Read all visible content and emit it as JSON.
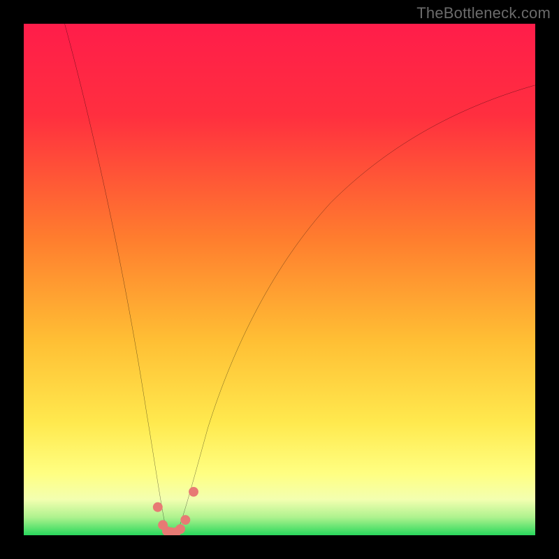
{
  "watermark": "TheBottleneck.com",
  "colors": {
    "frame": "#000000",
    "top": "#ff1d4a",
    "mid1": "#ff6a2a",
    "mid2": "#ffd33a",
    "lower": "#ffff84",
    "band_light": "#f6ffa8",
    "green": "#2bdc5f",
    "curve": "#000000",
    "marker": "#e77a74"
  },
  "chart_data": {
    "type": "line",
    "title": "",
    "xlabel": "",
    "ylabel": "",
    "xlim": [
      0,
      100
    ],
    "ylim": [
      0,
      100
    ],
    "series": [
      {
        "name": "bottleneck-curve",
        "x": [
          8,
          12,
          16,
          20,
          23,
          25,
          26.5,
          27.5,
          28.5,
          29.5,
          30.5,
          32,
          34,
          38,
          44,
          52,
          62,
          74,
          88,
          100
        ],
        "y": [
          100,
          80,
          60,
          40,
          22,
          10,
          4,
          1,
          0,
          0,
          1,
          4,
          11,
          24,
          40,
          54,
          66,
          76,
          83,
          88
        ]
      }
    ],
    "markers": {
      "name": "highlighted-points",
      "x": [
        26.2,
        27.2,
        28.0,
        28.8,
        29.8,
        30.6,
        31.6,
        33.2
      ],
      "y": [
        5.5,
        2.0,
        0.8,
        0.6,
        0.6,
        1.2,
        3.0,
        8.5
      ]
    },
    "background": {
      "type": "vertical-gradient",
      "stops": [
        {
          "pos": 0.0,
          "color": "#ff1d4a"
        },
        {
          "pos": 0.18,
          "color": "#ff2f3f"
        },
        {
          "pos": 0.42,
          "color": "#ff7d2e"
        },
        {
          "pos": 0.62,
          "color": "#ffbf34"
        },
        {
          "pos": 0.78,
          "color": "#ffe94e"
        },
        {
          "pos": 0.88,
          "color": "#ffff82"
        },
        {
          "pos": 0.93,
          "color": "#f3ffb0"
        },
        {
          "pos": 0.965,
          "color": "#aef28e"
        },
        {
          "pos": 1.0,
          "color": "#29d85c"
        }
      ]
    }
  }
}
